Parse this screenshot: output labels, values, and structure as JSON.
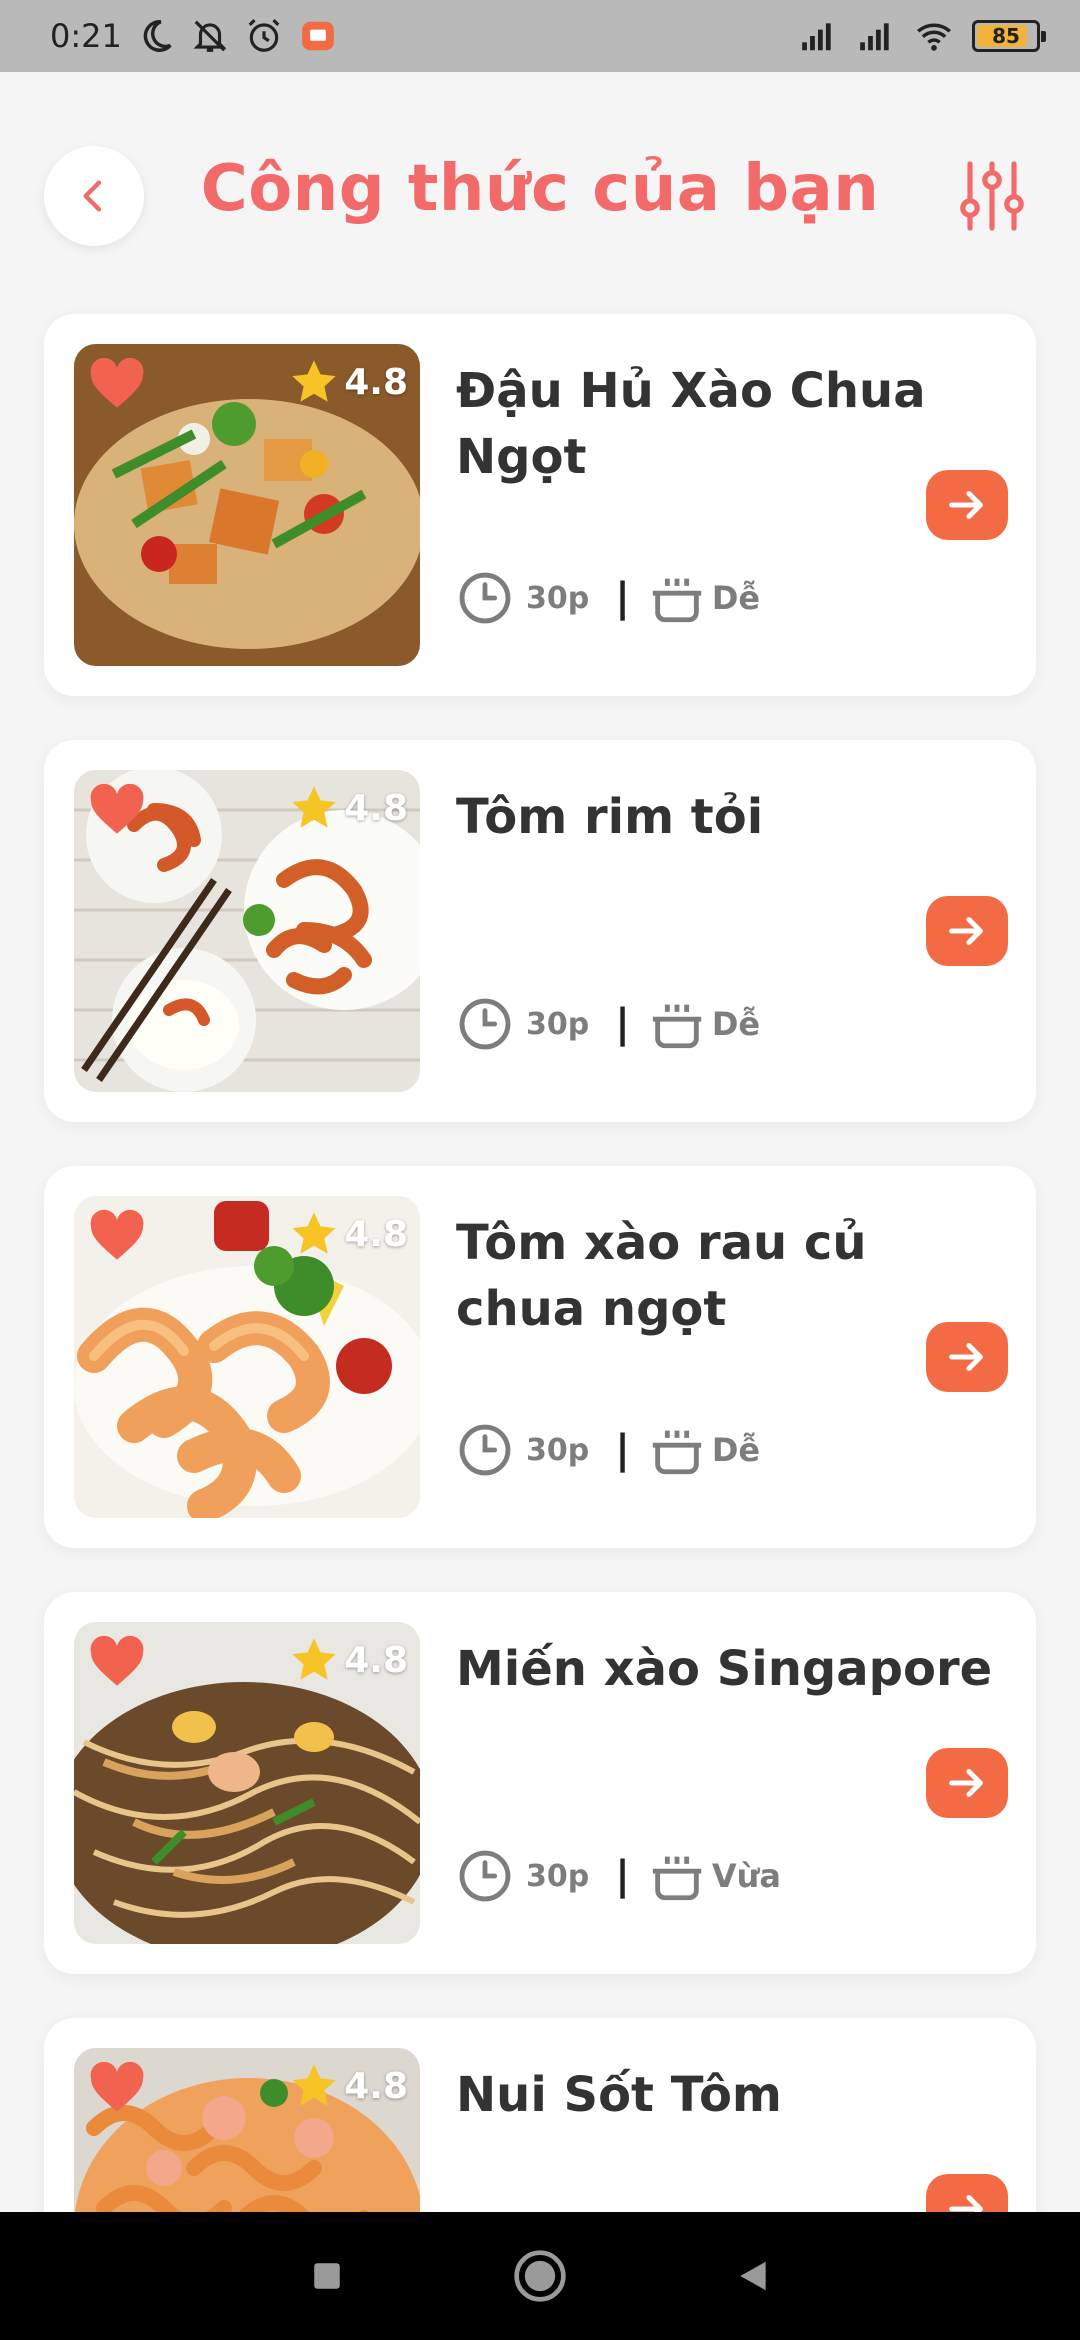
{
  "status_bar": {
    "time": "0:21",
    "battery": "85",
    "icons": [
      "moon-icon",
      "mute-icon",
      "alarm-icon",
      "app-notification-icon",
      "signal-icon",
      "signal-icon",
      "wifi-icon",
      "battery-icon"
    ]
  },
  "header": {
    "title": "Công thức của bạn",
    "back_icon": "chevron-left-icon",
    "filter_icon": "sliders-icon"
  },
  "recipes": [
    {
      "title": "Đậu Hủ Xào Chua Ngọt",
      "rating": "4.8",
      "time": "30p",
      "level": "Dễ",
      "favorite": true
    },
    {
      "title": "Tôm rim tỏi",
      "rating": "4.8",
      "time": "30p",
      "level": "Dễ",
      "favorite": true
    },
    {
      "title": "Tôm xào rau củ chua ngọt",
      "rating": "4.8",
      "time": "30p",
      "level": "Dễ",
      "favorite": true
    },
    {
      "title": "Miến xào Singapore",
      "rating": "4.8",
      "time": "30p",
      "level": "Vừa",
      "favorite": true
    },
    {
      "title": "Nui Sốt Tôm",
      "rating": "4.8",
      "time": "",
      "level": "",
      "favorite": true
    }
  ],
  "colors": {
    "accent": "#f26a6a",
    "button": "#f26b45",
    "heart": "#f2634f",
    "star": "#f7c425",
    "meta_text": "#7d7d7d"
  },
  "nav_bar": {
    "icons": [
      "recent-apps-icon",
      "home-icon",
      "back-icon"
    ]
  }
}
